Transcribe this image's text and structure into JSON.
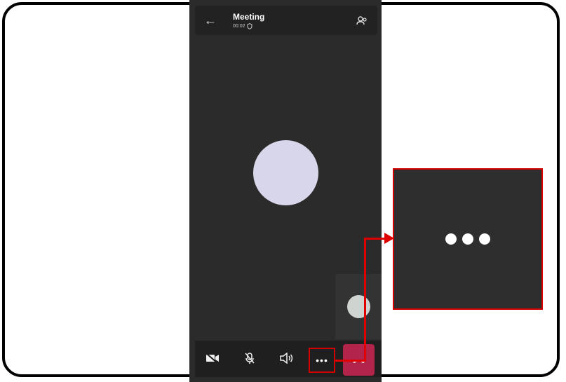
{
  "header": {
    "title": "Meeting",
    "duration": "00:02"
  },
  "controls": {
    "more_label": "•••"
  },
  "colors": {
    "accent": "#d40000",
    "hangup": "#b3244a"
  },
  "icons": [
    "back-arrow-icon",
    "shield-icon",
    "participants-icon",
    "video-off-icon",
    "mic-off-icon",
    "speaker-icon",
    "more-options-icon",
    "hang-up-icon"
  ]
}
